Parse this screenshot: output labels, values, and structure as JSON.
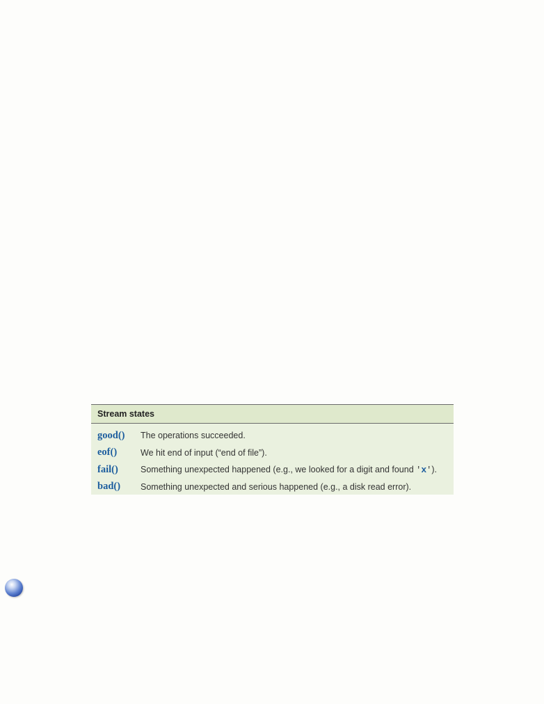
{
  "table": {
    "title": "Stream states",
    "rows": [
      {
        "function": "good()",
        "description": "The operations succeeded."
      },
      {
        "function": "eof()",
        "description": "We hit end of input (“end of file”)."
      },
      {
        "function": "fail()",
        "description_before": "Something unexpected happened (e.g., we looked for a digit and found ",
        "quote_open": "'",
        "code": "x",
        "quote_close": "'",
        "description_after": ")."
      },
      {
        "function": "bad()",
        "description": "Something unexpected and serious happened (e.g., a disk read error)."
      }
    ]
  },
  "colors": {
    "function_text": "#1c5d9e",
    "table_background": "#eaf1df",
    "header_background": "#dfe9cc",
    "margin_marker": "#3b5fbf"
  },
  "icons": {
    "margin_marker": "blue-sphere-icon"
  }
}
